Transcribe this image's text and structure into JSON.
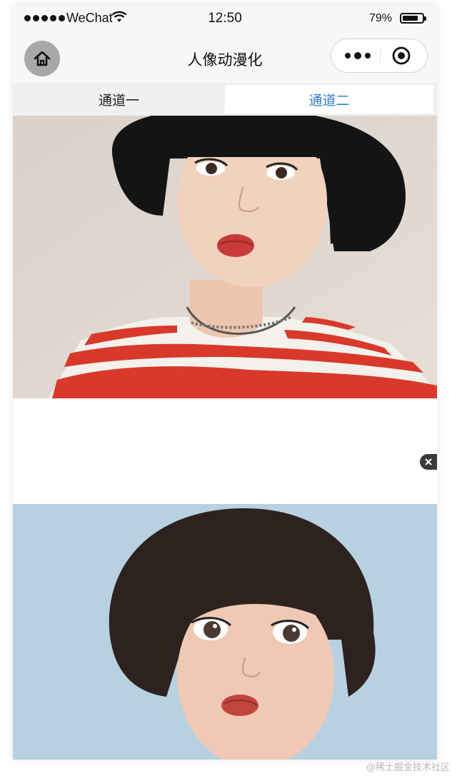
{
  "status_bar": {
    "carrier": "WeChat",
    "time": "12:50",
    "battery_percent": "79%",
    "battery_level": 0.79,
    "icons": [
      "signal-dots-icon",
      "wifi-icon",
      "battery-icon"
    ]
  },
  "nav": {
    "title": "人像动漫化",
    "home_icon": "home-icon",
    "more_icon": "more-dots-icon",
    "close_icon": "record-circle-icon"
  },
  "tabs": [
    {
      "label": "通道一",
      "active": false
    },
    {
      "label": "通道二",
      "active": true
    }
  ],
  "colors": {
    "active_tab": "#2f7fd6",
    "bar_background": "#f7f7f7",
    "tabs_background": "#f0f0f0"
  },
  "images": {
    "original": "photo of girl with black bob haircut, red-white striped shirt, beige background",
    "result": "anime-style portrait of girl with bob haircut on light blue background"
  },
  "ad": {
    "close_icon": "close-icon"
  },
  "watermark": "@稀土掘金技术社区"
}
